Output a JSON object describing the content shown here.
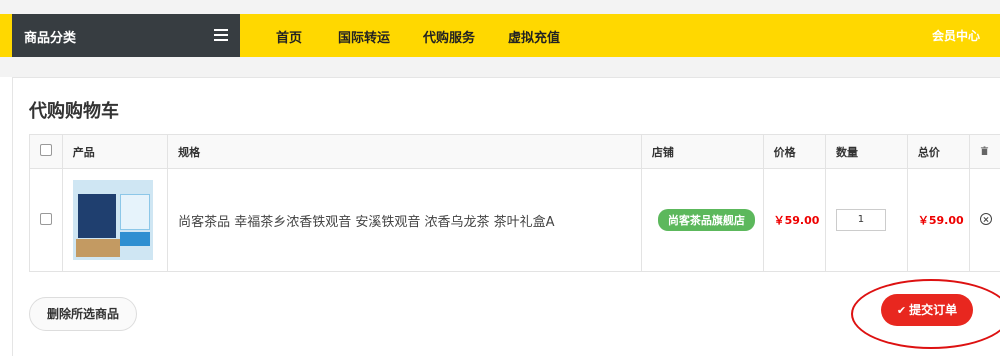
{
  "nav": {
    "category_label": "商品分类",
    "items": [
      {
        "label": "首页"
      },
      {
        "label": "国际转运"
      },
      {
        "label": "代购服务"
      },
      {
        "label": "虚拟充值"
      }
    ],
    "member_center": "会员中心"
  },
  "cart": {
    "title": "代购购物车",
    "headers": {
      "product": "产品",
      "spec": "规格",
      "store": "店铺",
      "price": "价格",
      "quantity": "数量",
      "total": "总价"
    },
    "rows": [
      {
        "spec": "尚客茶品 幸福茶乡浓香铁观音 安溪铁观音 浓香乌龙茶 茶叶礼盒A",
        "store": "尚客茶品旗舰店",
        "price": "￥59.00",
        "quantity": "1",
        "total": "￥59.00"
      }
    ],
    "delete_selected": "删除所选商品",
    "submit": "提交订单"
  },
  "colors": {
    "nav_bg": "#ffd800",
    "category_bg": "#373d41",
    "price": "#ee0000",
    "store_badge": "#5cb85c",
    "submit": "#e8271f"
  },
  "icons": [
    "menu-icon",
    "trash-icon",
    "remove-icon",
    "check-icon"
  ]
}
